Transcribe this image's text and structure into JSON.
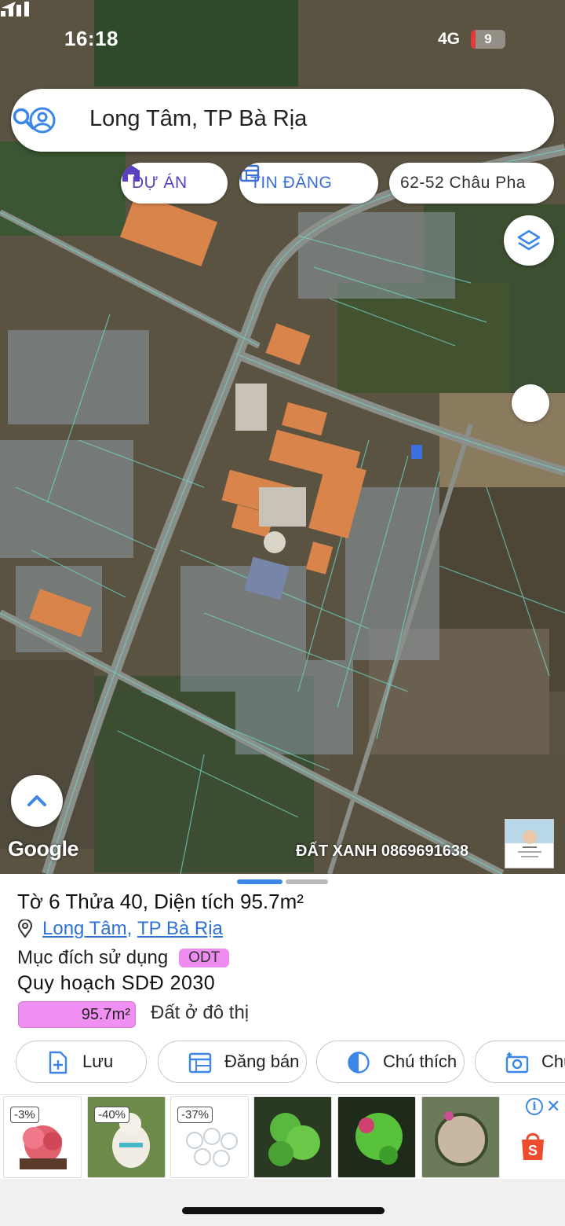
{
  "status_bar": {
    "time": "16:18",
    "network": "4G",
    "battery": "9"
  },
  "search": {
    "query": "Long Tâm, TP Bà Rịa"
  },
  "chips": {
    "project": "DỰ ÁN",
    "listing": "TIN ĐĂNG",
    "address": "62-52 Châu Pha"
  },
  "map": {
    "attribution": "Google",
    "watermark": "ĐẤT XANH 0869691638"
  },
  "parcel": {
    "title": "Tờ 6 Thửa 40, Diện tích 95.7m²",
    "ward": "Long Tâm",
    "city": "TP Bà Rịa",
    "separator": ",",
    "purpose_label": "Mục đích sử dụng",
    "purpose_code": "ODT",
    "plan": "Quy hoạch SDĐ 2030",
    "area": "95.7m²",
    "land_type": "Đất ở đô thị"
  },
  "actions": {
    "save": "Lưu",
    "sell": "Đăng bán",
    "legend": "Chú thích",
    "capture": "Chụp"
  },
  "ads": {
    "discounts": [
      "-3%",
      "-40%",
      "-37%"
    ]
  },
  "colors": {
    "accent": "#3b86e6",
    "odt": "#ef8cf0",
    "link": "#2f72d6"
  }
}
